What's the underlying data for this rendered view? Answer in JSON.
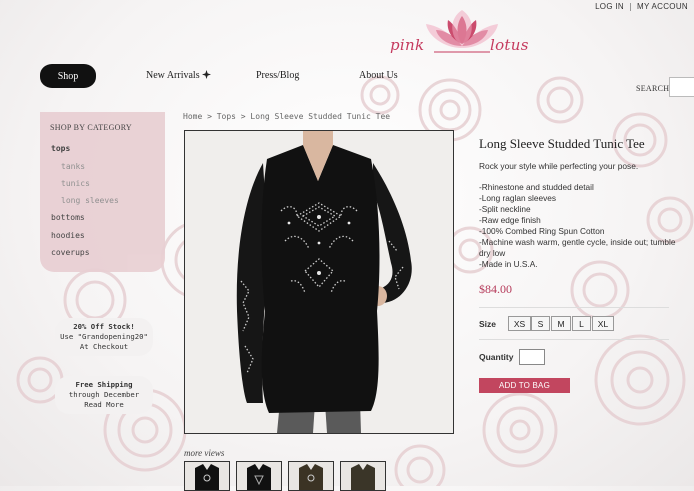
{
  "top_links": {
    "login": "LOG IN",
    "account": "MY ACCOUN"
  },
  "logo": {
    "text_left": "pink",
    "text_right": "lotus",
    "brand_color": "#c53a5e"
  },
  "nav": {
    "shop": "Shop",
    "new_arrivals": "New Arrivals",
    "new_arrivals_icon": "plus-cross-icon",
    "press": "Press/Blog",
    "about": "About Us"
  },
  "search": {
    "label": "SEARCH",
    "value": ""
  },
  "sidebar": {
    "title": "SHOP BY CATEGORY",
    "categories": [
      "tops",
      "tanks",
      "tunics",
      "long sleeves",
      "bottoms",
      "hoodies",
      "coverups"
    ]
  },
  "promos": [
    {
      "line1": "20% Off Stock!",
      "line2": "Use \"Grandopening20\"",
      "line3": "At Checkout"
    },
    {
      "line1": "Free Shipping",
      "line2": "through December",
      "line3": "Read More"
    }
  ],
  "breadcrumb": "Home > Tops > Long Sleeve Studded Tunic Tee",
  "product": {
    "title": "Long Sleeve Studded Tunic Tee",
    "tagline": "Rock your style while perfecting your pose.",
    "features": [
      "-Rhinestone and studded detail",
      "-Long raglan sleeves",
      "-Split neckline",
      "-Raw edge finish",
      "-100% Combed Ring Spun Cotton",
      "-Machine wash warm, gentle cycle, inside out; tumble dry low",
      "-Made in U.S.A."
    ],
    "price": "$84.00",
    "size_label": "Size",
    "sizes": [
      "XS",
      "S",
      "M",
      "L",
      "XL"
    ],
    "quantity_label": "Quantity",
    "quantity_value": "",
    "add_to_bag": "ADD TO BAG",
    "accent_color": "#c2465f"
  },
  "more_views": "more views"
}
